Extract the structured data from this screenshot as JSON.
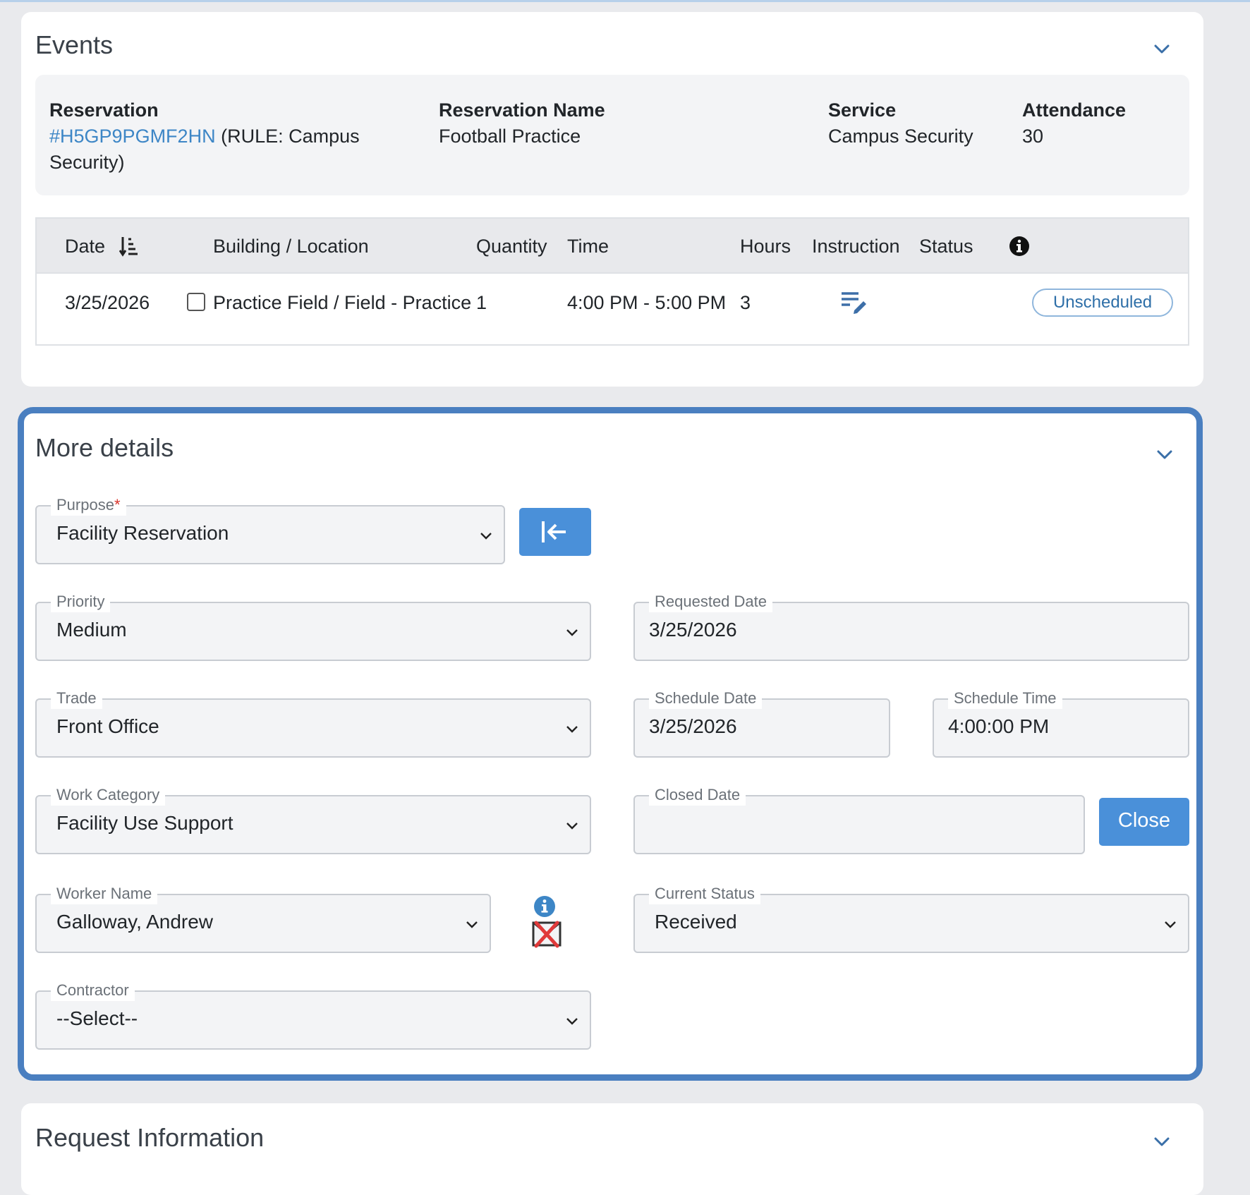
{
  "events": {
    "title": "Events",
    "summary": {
      "reservation_label": "Reservation",
      "reservation_link": "#H5GP9PGMF2HN",
      "reservation_rule_line1": " (RULE: Campus",
      "reservation_rule_line2": "Security)",
      "name_label": "Reservation Name",
      "name_value": "Football Practice",
      "service_label": "Service",
      "service_value": "Campus Security",
      "attendance_label": "Attendance",
      "attendance_value": "30"
    },
    "table": {
      "headers": {
        "date": "Date",
        "building": "Building / Location",
        "quantity": "Quantity",
        "time": "Time",
        "hours": "Hours",
        "instruction": "Instruction",
        "status": "Status"
      },
      "rows": [
        {
          "date": "3/25/2026",
          "building": "Practice Field / Field - Practice",
          "quantity": "1",
          "time": "4:00 PM - 5:00 PM",
          "hours": "3",
          "status": "Unscheduled"
        }
      ]
    }
  },
  "more_details": {
    "title": "More details",
    "purpose": {
      "label": "Purpose",
      "required_mark": "*",
      "value": "Facility Reservation"
    },
    "priority": {
      "label": "Priority",
      "value": "Medium"
    },
    "requested_date": {
      "label": "Requested Date",
      "value": "3/25/2026"
    },
    "trade": {
      "label": "Trade",
      "value": "Front Office"
    },
    "schedule_date": {
      "label": "Schedule Date",
      "value": "3/25/2026"
    },
    "schedule_time": {
      "label": "Schedule Time",
      "value": "4:00:00 PM"
    },
    "work_category": {
      "label": "Work Category",
      "value": "Facility Use Support"
    },
    "closed_date": {
      "label": "Closed Date",
      "value": ""
    },
    "close_button": "Close",
    "worker_name": {
      "label": "Worker Name",
      "value": "Galloway, Andrew"
    },
    "current_status": {
      "label": "Current Status",
      "value": "Received"
    },
    "contractor": {
      "label": "Contractor",
      "value": "--Select--"
    }
  },
  "request_information": {
    "title": "Request Information"
  },
  "colors": {
    "accent": "#4a90d9",
    "panel_border": "#4a7fc0",
    "link": "#3d86c6"
  }
}
